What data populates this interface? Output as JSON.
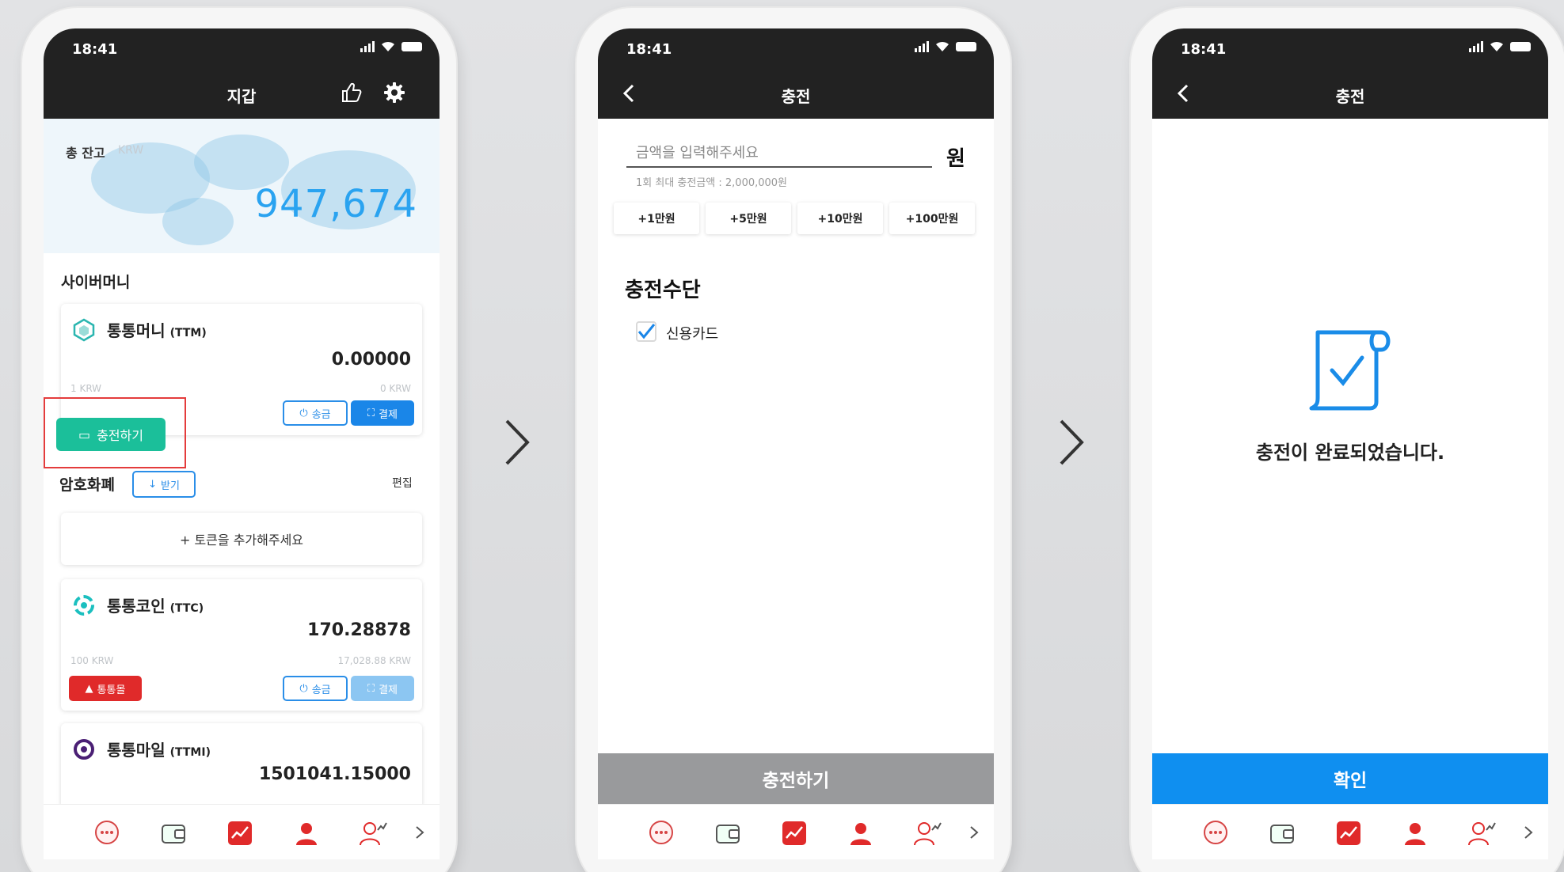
{
  "status": {
    "time": "18:41"
  },
  "screen1": {
    "title": "지갑",
    "balance": {
      "label": "총 잔고",
      "unit": "KRW",
      "value": "947,674"
    },
    "cyber_section": "사이버머니",
    "ttm": {
      "name": "통통머니",
      "code": "(TTM)",
      "amount": "0.00000",
      "rate": "1 KRW",
      "krw": "0 KRW",
      "send": "송금",
      "pay": "결제",
      "charge": "충전하기"
    },
    "crypto_section": "암호화폐",
    "receive": "받기",
    "edit": "편집",
    "add_token": "+ 토큰을 추가해주세요",
    "ttc": {
      "name": "통통코인",
      "code": "(TTC)",
      "amount": "170.28878",
      "rate": "100 KRW",
      "krw": "17,028.88 KRW",
      "mall": "통통몰",
      "send": "송금",
      "pay": "결제"
    },
    "ttmi": {
      "name": "통통마일",
      "code": "(TTMI)",
      "amount": "1501041.15000"
    }
  },
  "screen2": {
    "title": "충전",
    "placeholder": "금액을 입력해주세요",
    "won": "원",
    "max_note": "1회 최대 충전금액 : 2,000,000원",
    "quick": [
      "+1만원",
      "+5만원",
      "+10만원",
      "+100만원"
    ],
    "method_title": "충전수단",
    "method": "신용카드",
    "submit": "충전하기"
  },
  "screen3": {
    "title": "충전",
    "message": "충전이 완료되었습니다.",
    "confirm": "확인"
  },
  "colors": {
    "header": "#222222",
    "accent_blue": "#1a86e8",
    "balance_blue": "#2aa3f0",
    "charge_green": "#1bbf9a",
    "highlight_red": "#e43c3c",
    "confirm_blue": "#0f8ff0",
    "submit_gray": "#999a9c"
  },
  "tab_icons": [
    "chat-icon",
    "wallet-icon",
    "chart-icon",
    "person-icon",
    "people-icon",
    "chevron-right-icon"
  ]
}
